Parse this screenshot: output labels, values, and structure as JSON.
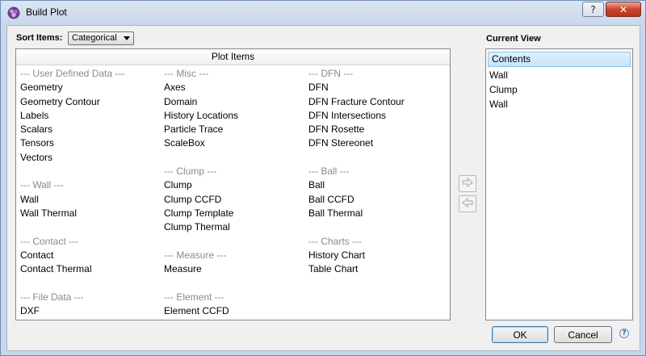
{
  "window": {
    "title": "Build Plot",
    "help_button": "?",
    "close_button": "✕"
  },
  "sort": {
    "label": "Sort Items:",
    "value": "Categorical"
  },
  "plot_items": {
    "header": "Plot Items",
    "col1": [
      {
        "text": "--- User Defined Data ---",
        "heading": true
      },
      {
        "text": "Geometry"
      },
      {
        "text": "Geometry Contour"
      },
      {
        "text": "Labels"
      },
      {
        "text": "Scalars"
      },
      {
        "text": "Tensors"
      },
      {
        "text": "Vectors"
      },
      {
        "text": ""
      },
      {
        "text": "--- Wall ---",
        "heading": true
      },
      {
        "text": "Wall"
      },
      {
        "text": "Wall Thermal"
      },
      {
        "text": ""
      },
      {
        "text": "--- Contact ---",
        "heading": true
      },
      {
        "text": "Contact"
      },
      {
        "text": "Contact Thermal"
      },
      {
        "text": ""
      },
      {
        "text": "--- File Data ---",
        "heading": true
      },
      {
        "text": "DXF"
      }
    ],
    "col2": [
      {
        "text": "--- Misc ---",
        "heading": true
      },
      {
        "text": "Axes"
      },
      {
        "text": "Domain"
      },
      {
        "text": "History Locations"
      },
      {
        "text": "Particle Trace"
      },
      {
        "text": "ScaleBox"
      },
      {
        "text": ""
      },
      {
        "text": "--- Clump ---",
        "heading": true
      },
      {
        "text": "Clump"
      },
      {
        "text": "Clump CCFD"
      },
      {
        "text": "Clump Template"
      },
      {
        "text": "Clump Thermal"
      },
      {
        "text": ""
      },
      {
        "text": "--- Measure ---",
        "heading": true
      },
      {
        "text": "Measure"
      },
      {
        "text": ""
      },
      {
        "text": "--- Element ---",
        "heading": true
      },
      {
        "text": "Element CCFD"
      }
    ],
    "col3": [
      {
        "text": "--- DFN ---",
        "heading": true
      },
      {
        "text": "DFN"
      },
      {
        "text": "DFN Fracture Contour"
      },
      {
        "text": "DFN Intersections"
      },
      {
        "text": "DFN Rosette"
      },
      {
        "text": "DFN Stereonet"
      },
      {
        "text": ""
      },
      {
        "text": "--- Ball ---",
        "heading": true
      },
      {
        "text": "Ball"
      },
      {
        "text": "Ball CCFD"
      },
      {
        "text": "Ball Thermal"
      },
      {
        "text": ""
      },
      {
        "text": "--- Charts ---",
        "heading": true
      },
      {
        "text": "History Chart"
      },
      {
        "text": "Table Chart"
      }
    ]
  },
  "current_view": {
    "label": "Current View",
    "root": "Contents",
    "items": [
      "Wall",
      "Clump",
      "Wall"
    ]
  },
  "buttons": {
    "ok": "OK",
    "cancel": "Cancel",
    "help": "?"
  },
  "icons": {
    "app": "app-logo-icon",
    "add": "arrow-right-icon",
    "remove": "arrow-left-icon"
  }
}
